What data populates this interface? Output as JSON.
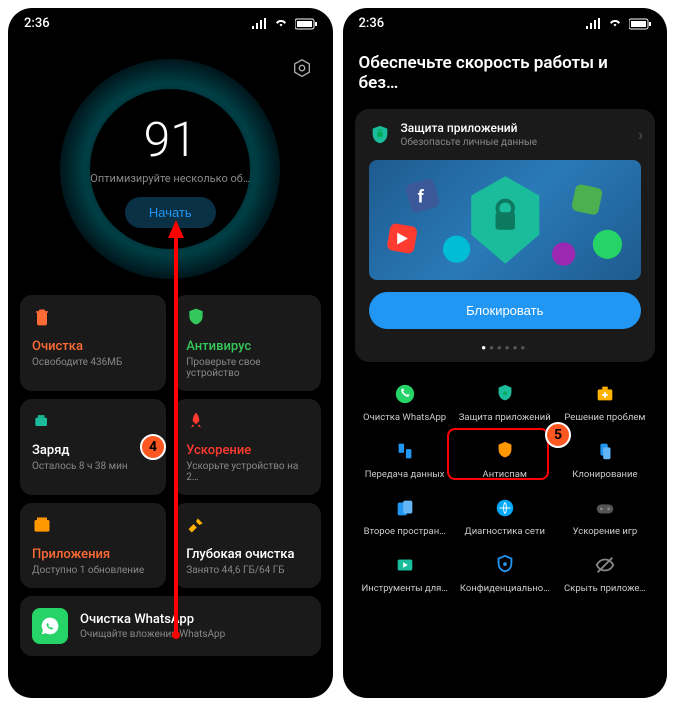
{
  "status": {
    "time": "2:36"
  },
  "screen1": {
    "score": "91",
    "score_sub": "Оптимизируйте несколько об…",
    "start": "Начать",
    "cards": [
      {
        "title": "Очистка",
        "sub": "Освободите 436МБ",
        "color": "t-orange",
        "icon": "trash"
      },
      {
        "title": "Антивирус",
        "sub": "Проверьте свое устройство",
        "color": "t-green",
        "icon": "shield"
      },
      {
        "title": "Заряд",
        "sub": "Осталось 8 ч 38 мин",
        "color": "t-white",
        "icon": "battery"
      },
      {
        "title": "Ускорение",
        "sub": "Ускорьте устройство на 2…",
        "color": "t-red",
        "icon": "rocket"
      },
      {
        "title": "Приложения",
        "sub": "Доступно 1 обновление",
        "color": "t-orange",
        "icon": "apps"
      },
      {
        "title": "Глубокая очистка",
        "sub": "Занято 44,6 ГБ/64 ГБ",
        "color": "t-white",
        "icon": "broom"
      }
    ],
    "whatsapp": {
      "title": "Очистка WhatsApp",
      "sub": "Очищайте вложения WhatsApp"
    }
  },
  "screen2": {
    "header": "Обеспечьте скорость работы и без…",
    "promo": {
      "title": "Защита приложений",
      "sub": "Обезопасьте личные данные",
      "button": "Блокировать"
    },
    "tools": [
      {
        "label": "Очистка WhatsApp",
        "icon": "whatsapp",
        "color": "#25d366"
      },
      {
        "label": "Защита приложений",
        "icon": "shield-lock",
        "color": "#1abc9c"
      },
      {
        "label": "Решение проблем",
        "icon": "medkit",
        "color": "#ffb300"
      },
      {
        "label": "Передача данных",
        "icon": "transfer",
        "color": "#2196f3"
      },
      {
        "label": "Антиспам",
        "icon": "antispam",
        "color": "#ff9800"
      },
      {
        "label": "Клонирование",
        "icon": "clone",
        "color": "#2196f3"
      },
      {
        "label": "Второе простран…",
        "icon": "space2",
        "color": "#2196f3"
      },
      {
        "label": "Диагностика сети",
        "icon": "network",
        "color": "#03a9f4"
      },
      {
        "label": "Ускорение игр",
        "icon": "gamepad",
        "color": "#555"
      },
      {
        "label": "Инструменты для…",
        "icon": "video-tools",
        "color": "#1abc9c"
      },
      {
        "label": "Конфиденциально…",
        "icon": "privacy",
        "color": "#2196f3"
      },
      {
        "label": "Скрыть приложе…",
        "icon": "hide",
        "color": "#888"
      }
    ]
  },
  "annotations": {
    "badge4": "4",
    "badge5": "5"
  }
}
